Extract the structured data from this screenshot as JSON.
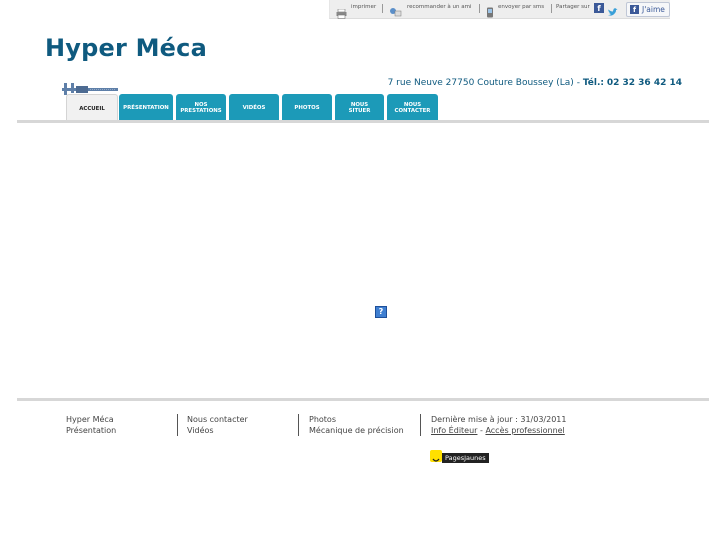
{
  "toolbar": {
    "print": "imprimer",
    "recommend": "recommander à un ami",
    "sms": "envoyer par sms",
    "share": "Partager sur",
    "like": "J'aime"
  },
  "site": {
    "title": "Hyper Méca",
    "address": "7 rue Neuve 27750 Couture Boussey (La)",
    "phone_label": "Tél.:",
    "phone": "02 32 36 42 14"
  },
  "nav": {
    "items": [
      {
        "label": "ACCUEIL"
      },
      {
        "label": "PRÉSENTATION"
      },
      {
        "label": "NOS PRESTATIONS"
      },
      {
        "label": "VIDÉOS"
      },
      {
        "label": "PHOTOS"
      },
      {
        "label": "NOUS SITUER"
      },
      {
        "label": "NOUS CONTACTER"
      }
    ]
  },
  "content": {
    "missing_plugin": "?"
  },
  "footer": {
    "col1": [
      "Hyper Méca",
      "Présentation"
    ],
    "col2": [
      "Nous contacter",
      "Vidéos"
    ],
    "col3": [
      "Photos",
      "Mécanique de précision"
    ],
    "updated": "Dernière mise à jour : 31/03/2011",
    "info_editeur": "Info Éditeur",
    "dash": "-",
    "acces_pro": "Accès professionnel",
    "pagesjaunes": "PagesJaunes"
  },
  "colors": {
    "brand": "#0f5a7f",
    "tab": "#1c9ab8"
  }
}
